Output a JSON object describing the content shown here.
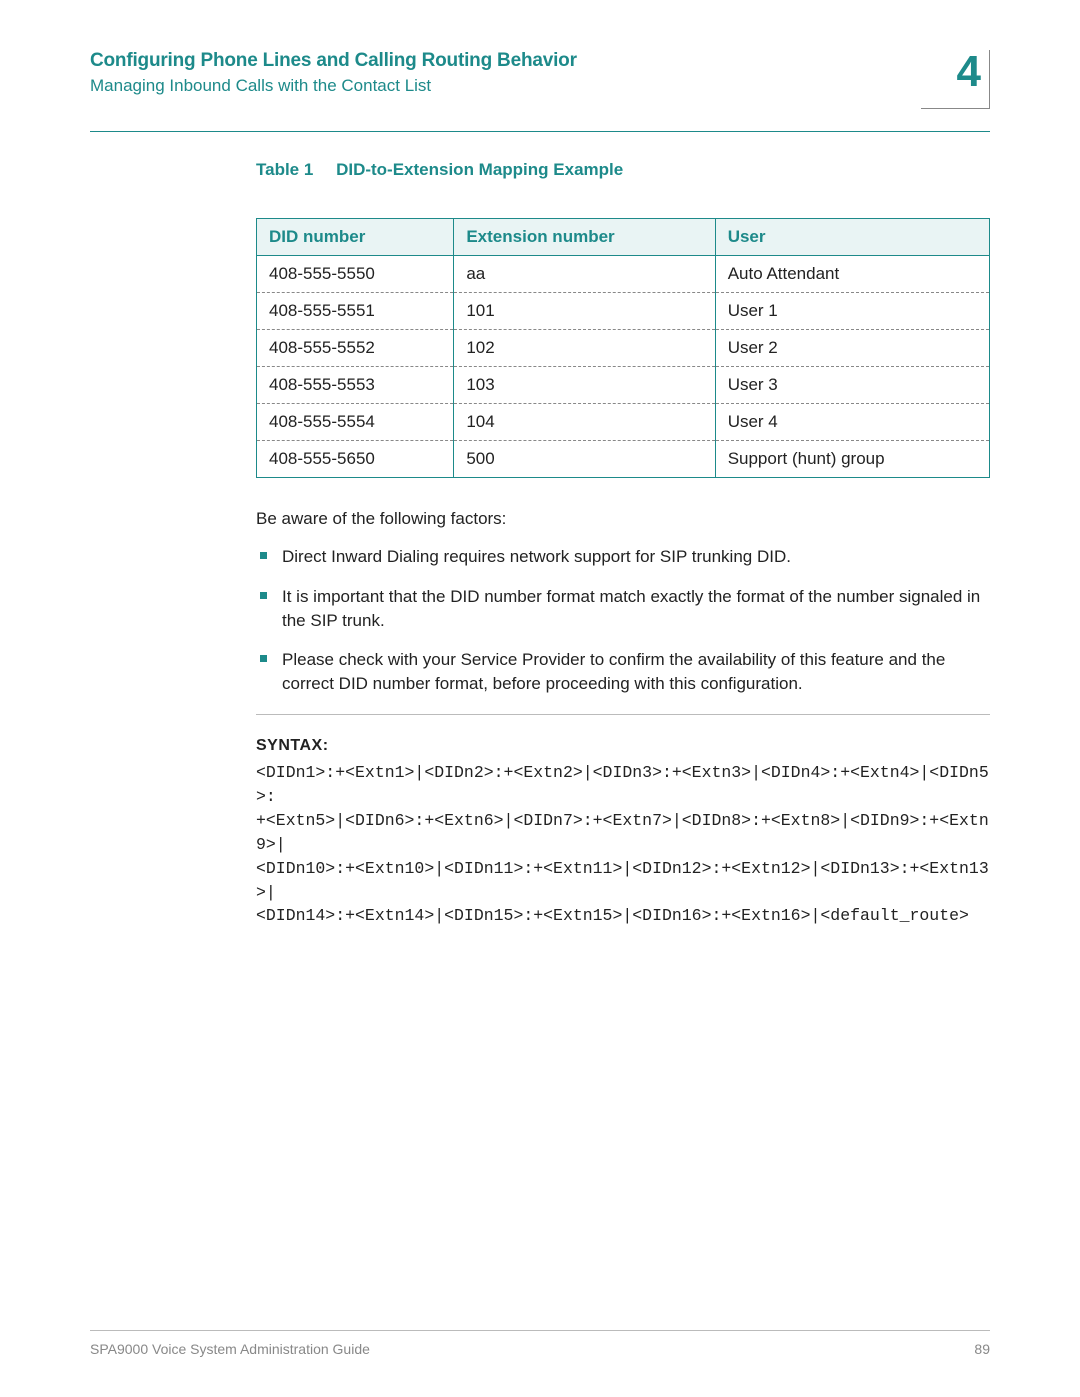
{
  "header": {
    "title": "Configuring Phone Lines and Calling Routing Behavior",
    "subtitle": "Managing Inbound Calls with the Contact List",
    "chapter": "4"
  },
  "table": {
    "caption_label": "Table 1",
    "caption_title": "DID-to-Extension Mapping Example",
    "headers": [
      "DID number",
      "Extension number",
      "User"
    ],
    "rows": [
      [
        "408-555-5550",
        "aa",
        "Auto Attendant"
      ],
      [
        "408-555-5551",
        "101",
        "User 1"
      ],
      [
        "408-555-5552",
        "102",
        "User 2"
      ],
      [
        "408-555-5553",
        "103",
        "User 3"
      ],
      [
        "408-555-5554",
        "104",
        "User 4"
      ],
      [
        "408-555-5650",
        "500",
        "Support (hunt) group"
      ]
    ]
  },
  "body": {
    "intro": "Be aware of the following factors:",
    "factors": [
      "Direct Inward Dialing requires network support for SIP trunking DID.",
      "It is important that the DID number format match exactly the format of the number signaled in the SIP trunk.",
      "Please check with your Service Provider to confirm the availability of this feature and the correct DID number format, before proceeding with this configuration."
    ]
  },
  "syntax": {
    "label": "SYNTAX:",
    "code": "<DIDn1>:+<Extn1>|<DIDn2>:+<Extn2>|<DIDn3>:+<Extn3>|<DIDn4>:+<Extn4>|<DIDn5>:\n+<Extn5>|<DIDn6>:+<Extn6>|<DIDn7>:+<Extn7>|<DIDn8>:+<Extn8>|<DIDn9>:+<Extn9>|\n<DIDn10>:+<Extn10>|<DIDn11>:+<Extn11>|<DIDn12>:+<Extn12>|<DIDn13>:+<Extn13>|\n<DIDn14>:+<Extn14>|<DIDn15>:+<Extn15>|<DIDn16>:+<Extn16>|<default_route>"
  },
  "footer": {
    "left": "SPA9000 Voice System Administration Guide",
    "right": "89"
  }
}
